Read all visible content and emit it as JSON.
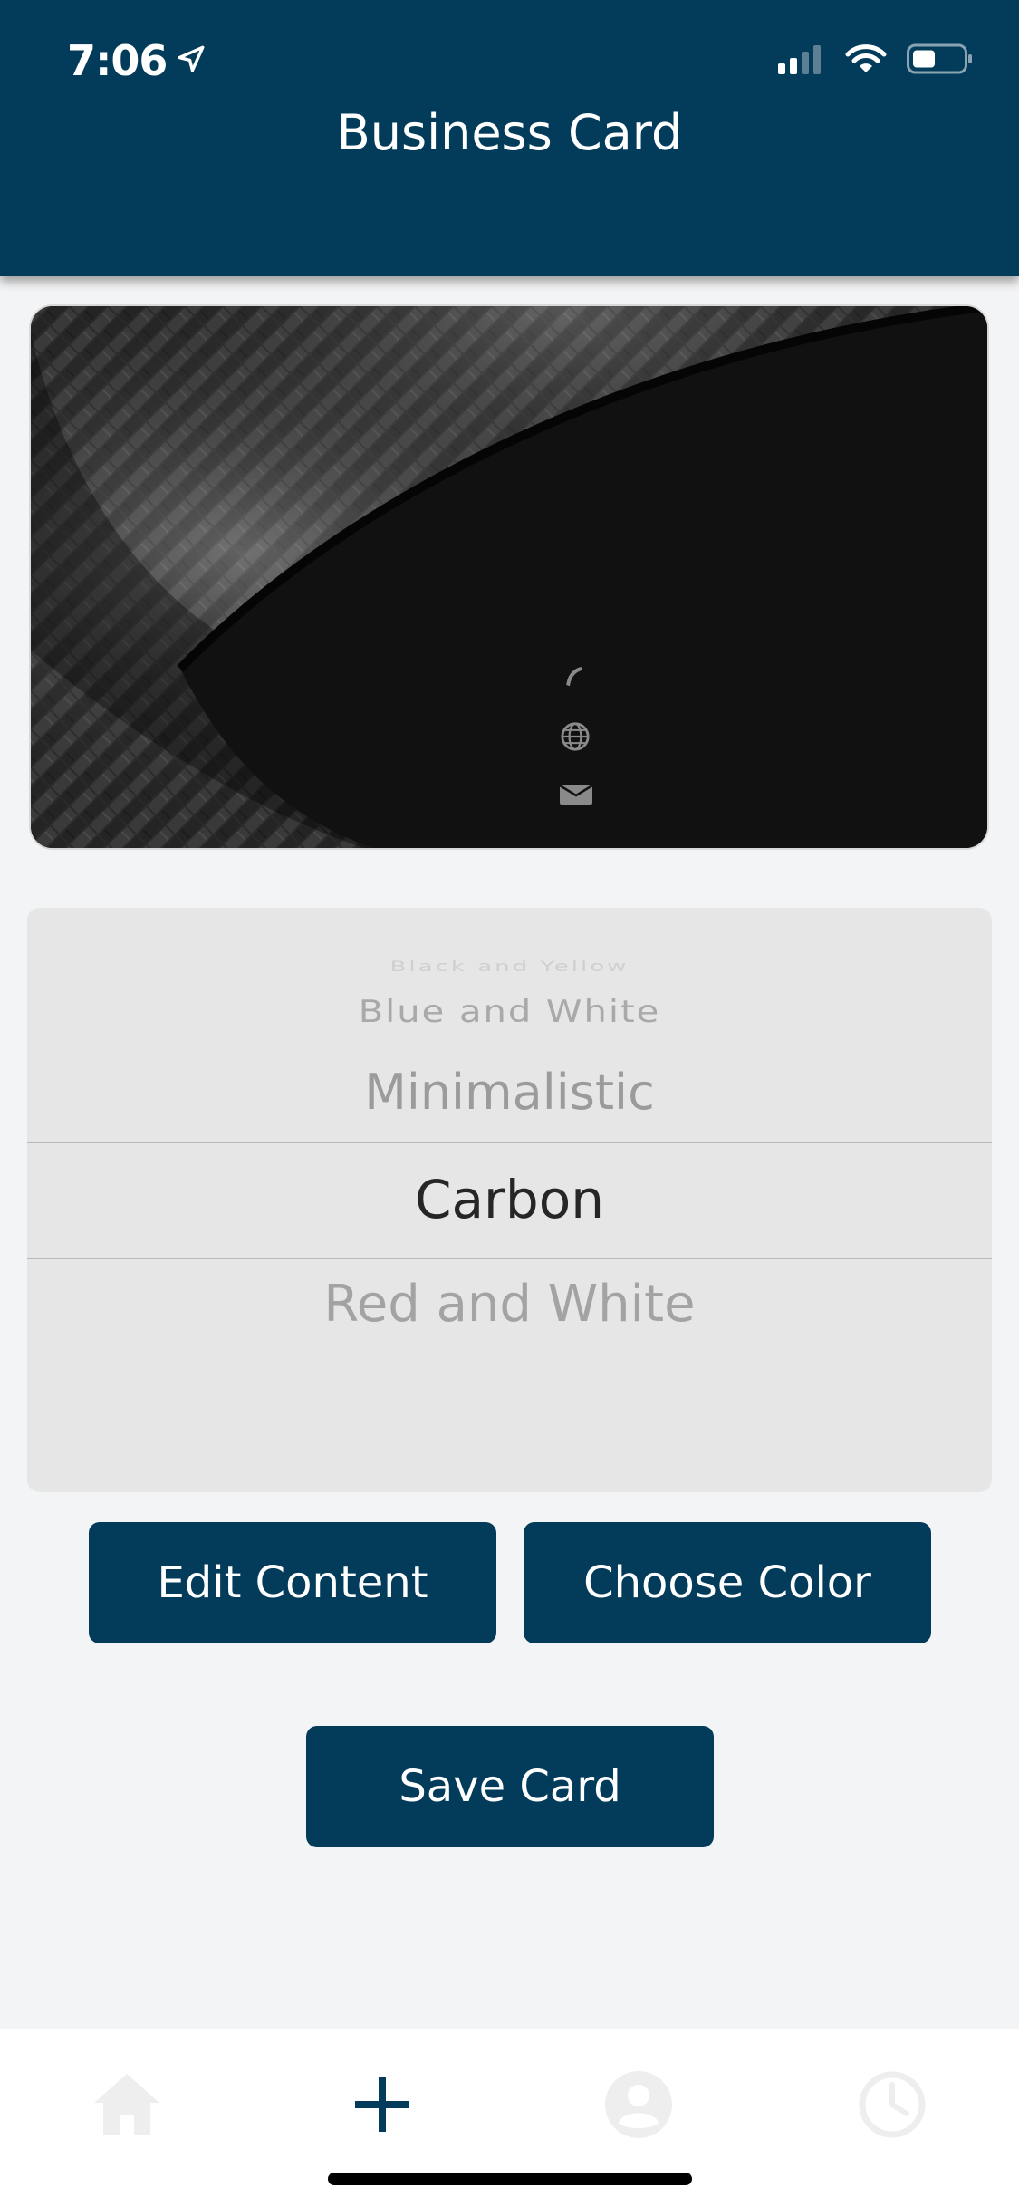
{
  "status_bar": {
    "time": "7:06",
    "icons": [
      "location-arrow-icon",
      "cellular-signal-icon",
      "wifi-icon",
      "battery-icon"
    ]
  },
  "header": {
    "title": "Business Card"
  },
  "card_preview": {
    "template": "carbon",
    "icons": [
      "phone-icon",
      "globe-icon",
      "envelope-icon"
    ]
  },
  "picker": {
    "options": [
      "Black and Yellow",
      "Blue and White",
      "Minimalistic",
      "Carbon",
      "Red and White"
    ],
    "selected": "Carbon"
  },
  "buttons": {
    "edit_content": "Edit Content",
    "choose_color": "Choose Color",
    "save_card": "Save Card"
  },
  "tabbar": {
    "tabs": [
      {
        "icon": "home-icon",
        "active": false
      },
      {
        "icon": "plus-icon",
        "active": true
      },
      {
        "icon": "user-icon",
        "active": false
      },
      {
        "icon": "clock-icon",
        "active": false
      }
    ]
  },
  "colors": {
    "primary": "#033c5a",
    "background": "#f3f4f5",
    "picker_bg": "#e6e6e6",
    "inactive_tab": "#eeeeee"
  }
}
